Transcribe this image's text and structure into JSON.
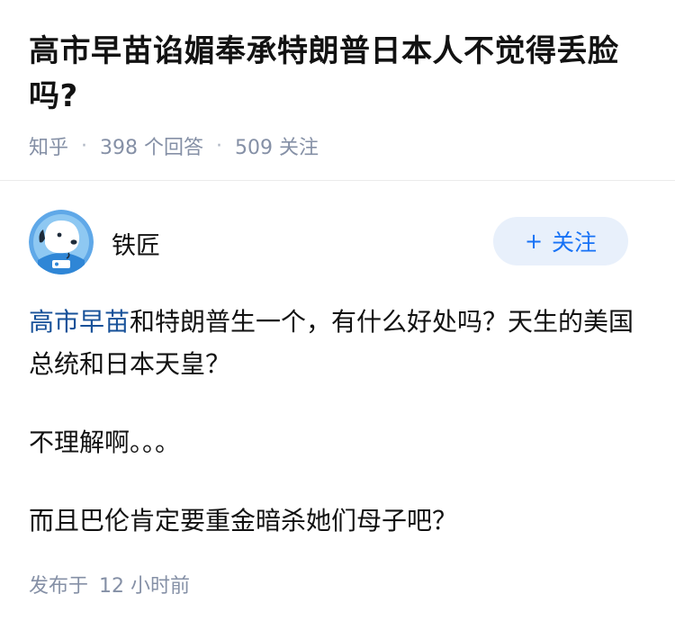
{
  "question": {
    "title": "高市早苗谄媚奉承特朗普日本人不觉得丢脸吗?",
    "meta": {
      "source": "知乎",
      "answer_count": "398",
      "answer_unit": "个回答",
      "follow_count": "509",
      "follow_unit": "关注",
      "separator": "·"
    }
  },
  "answer": {
    "author": {
      "name": "铁匠",
      "avatar_icon": "cartoon-dog-astronaut-avatar"
    },
    "follow_button": {
      "icon": "plus-icon",
      "label": "关注",
      "plus_glyph": "+"
    },
    "paragraphs": [
      {
        "link_text": "高市早苗",
        "text": "和特朗普生一个，有什么好处吗？天生的美国总统和日本天皇？"
      },
      {
        "text": "不理解啊。。。"
      },
      {
        "text": "而且巴伦肯定要重金暗杀她们母子吧？"
      }
    ],
    "footer": {
      "label": "发布于",
      "time": "12 小时前"
    }
  },
  "colors": {
    "link": "#175199",
    "meta": "#8590a6",
    "button_bg": "#e8f0fb",
    "button_text": "#1772f6",
    "avatar_bg": "#5fa8e8"
  }
}
